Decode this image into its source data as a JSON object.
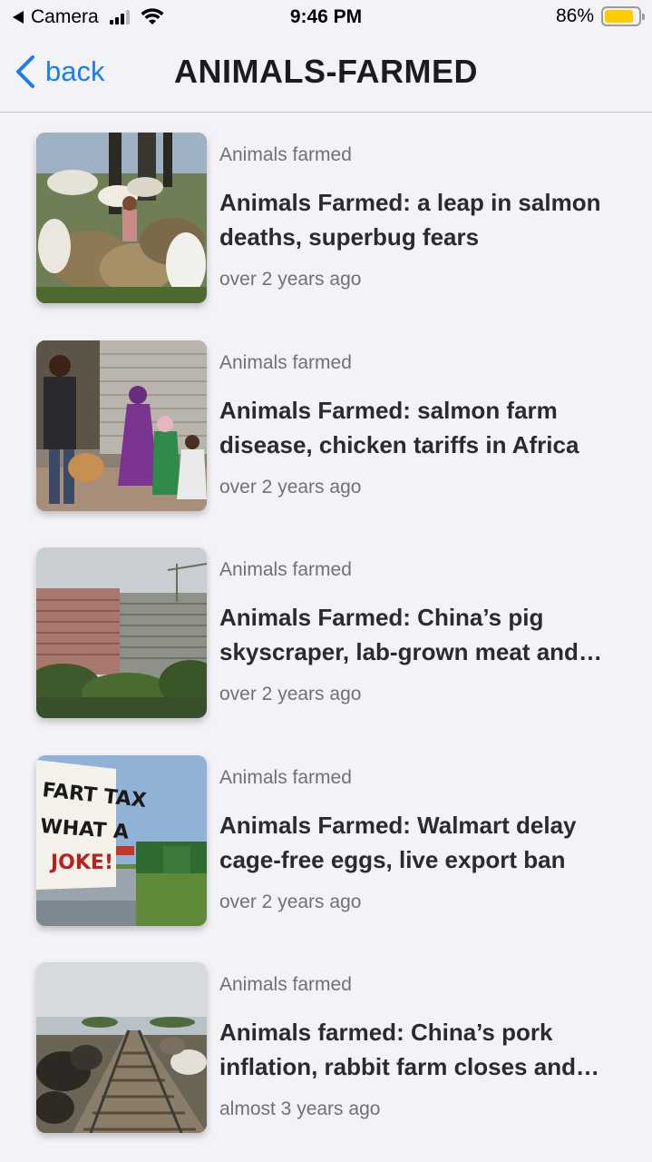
{
  "status_bar": {
    "carrier_back": "Camera",
    "time": "9:46 PM",
    "battery_percent": "86%",
    "battery_level": 0.86
  },
  "nav": {
    "back_label": "back",
    "title": "ANIMALS-FARMED"
  },
  "colors": {
    "accent": "#1a7cf0",
    "background": "#f2f2f7",
    "battery": "#ffcc00"
  },
  "articles": [
    {
      "category": "Animals farmed",
      "title": "Animals Farmed: a leap in salmon deaths, superbug fears",
      "time": "over 2 years ago",
      "image": "goats-on-rocks-photo"
    },
    {
      "category": "Animals farmed",
      "title": "Animals Farmed: salmon farm disease, chicken tariffs in Africa",
      "time": "over 2 years ago",
      "image": "street-poultry-market-photo"
    },
    {
      "category": "Animals farmed",
      "title": "Animals Farmed: China’s pig skyscraper, lab-grown meat and more",
      "time": "over 2 years ago",
      "image": "high-rise-buildings-photo"
    },
    {
      "category": "Animals farmed",
      "title": "Animals Farmed: Walmart delay cage-free eggs, live export ban",
      "time": "over 2 years ago",
      "image": "fart-tax-protest-sign-photo",
      "sign_text": [
        "FART TAX",
        "WHAT A",
        "JOKE!"
      ]
    },
    {
      "category": "Animals farmed",
      "title": "Animals farmed: China’s pork inflation, rabbit farm closes and more",
      "time": "almost 3 years ago",
      "image": "cattle-on-railway-photo"
    }
  ]
}
